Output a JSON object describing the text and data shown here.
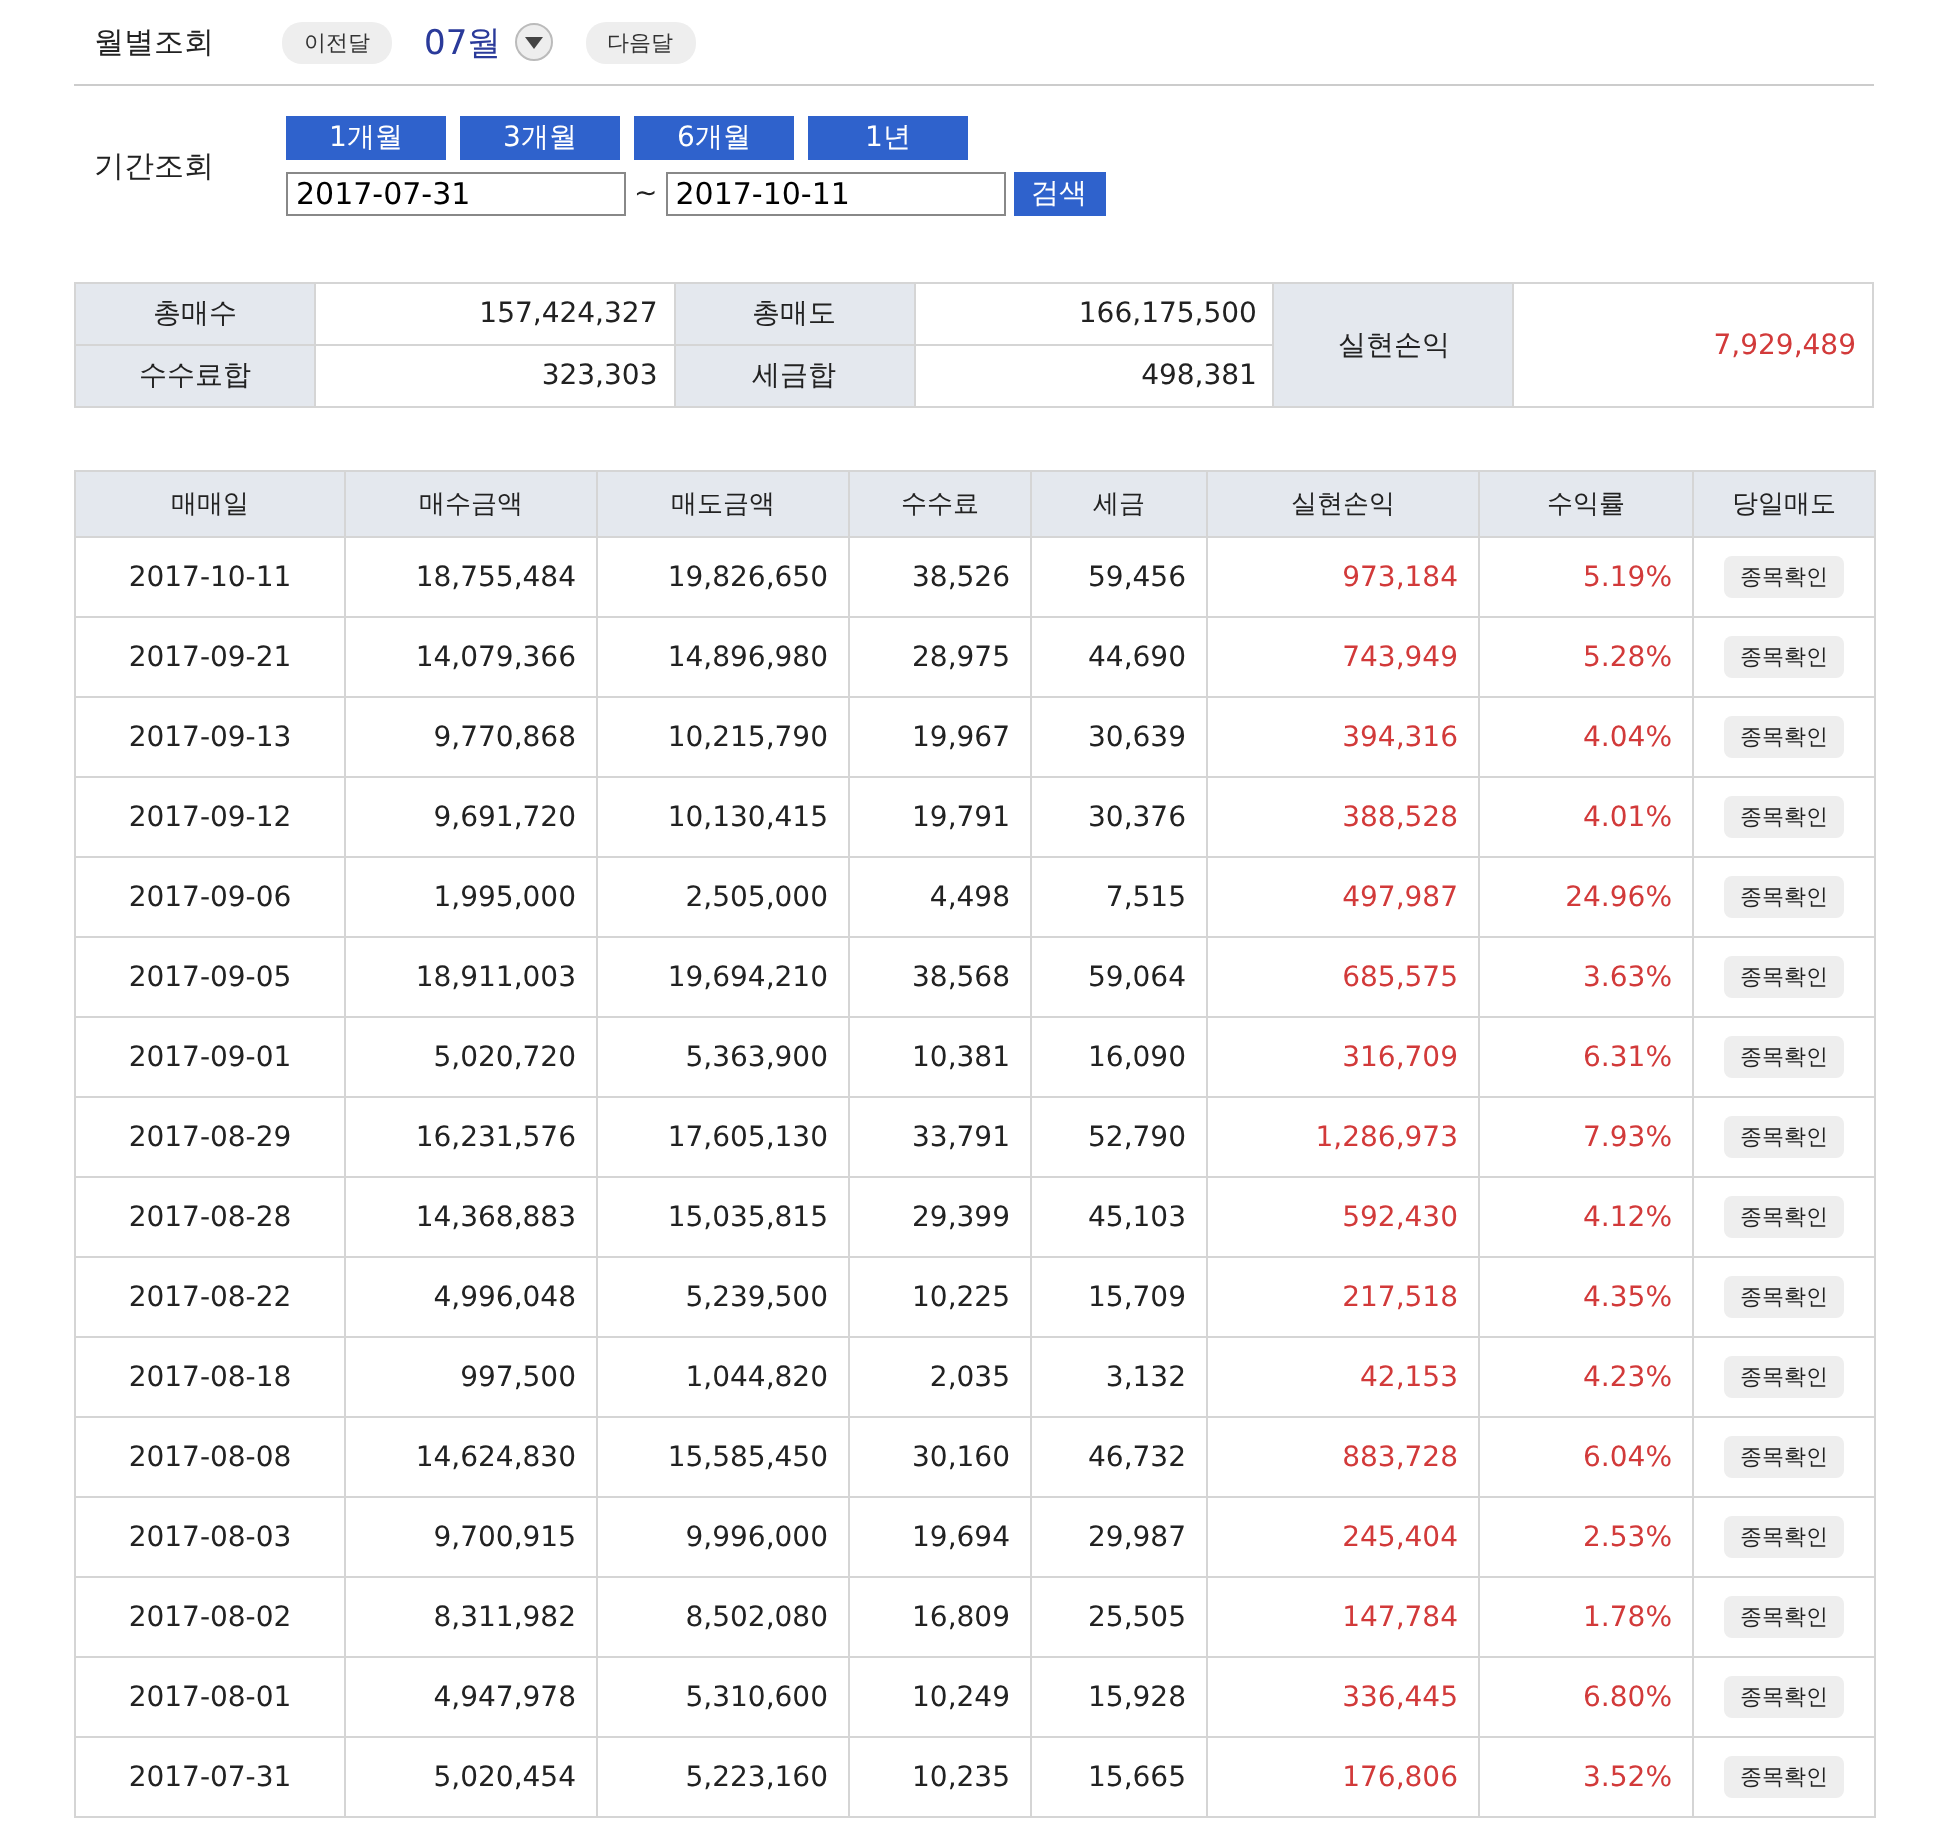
{
  "monthly": {
    "label": "월별조회",
    "prev": "이전달",
    "month": "07월",
    "next": "다음달"
  },
  "period": {
    "label": "기간조회",
    "presets": [
      "1개월",
      "3개월",
      "6개월",
      "1년"
    ],
    "from": "2017-07-31",
    "separator": "~",
    "to": "2017-10-11",
    "search": "검색"
  },
  "summary": {
    "buy_label": "총매수",
    "buy": "157,424,327",
    "sell_label": "총매도",
    "sell": "166,175,500",
    "fee_label": "수수료합",
    "fee": "323,303",
    "tax_label": "세금합",
    "tax": "498,381",
    "profit_label": "실현손익",
    "profit": "7,929,489"
  },
  "table": {
    "columns": [
      "매매일",
      "매수금액",
      "매도금액",
      "수수료",
      "세금",
      "실현손익",
      "수익률",
      "당일매도"
    ],
    "rows": [
      {
        "date": "2017-10-11",
        "buy": "18,755,484",
        "sell": "19,826,650",
        "fee": "38,526",
        "tax": "59,456",
        "profit": "973,184",
        "rate": "5.19%",
        "action": "종목확인"
      },
      {
        "date": "2017-09-21",
        "buy": "14,079,366",
        "sell": "14,896,980",
        "fee": "28,975",
        "tax": "44,690",
        "profit": "743,949",
        "rate": "5.28%",
        "action": "종목확인"
      },
      {
        "date": "2017-09-13",
        "buy": "9,770,868",
        "sell": "10,215,790",
        "fee": "19,967",
        "tax": "30,639",
        "profit": "394,316",
        "rate": "4.04%",
        "action": "종목확인"
      },
      {
        "date": "2017-09-12",
        "buy": "9,691,720",
        "sell": "10,130,415",
        "fee": "19,791",
        "tax": "30,376",
        "profit": "388,528",
        "rate": "4.01%",
        "action": "종목확인"
      },
      {
        "date": "2017-09-06",
        "buy": "1,995,000",
        "sell": "2,505,000",
        "fee": "4,498",
        "tax": "7,515",
        "profit": "497,987",
        "rate": "24.96%",
        "action": "종목확인"
      },
      {
        "date": "2017-09-05",
        "buy": "18,911,003",
        "sell": "19,694,210",
        "fee": "38,568",
        "tax": "59,064",
        "profit": "685,575",
        "rate": "3.63%",
        "action": "종목확인"
      },
      {
        "date": "2017-09-01",
        "buy": "5,020,720",
        "sell": "5,363,900",
        "fee": "10,381",
        "tax": "16,090",
        "profit": "316,709",
        "rate": "6.31%",
        "action": "종목확인"
      },
      {
        "date": "2017-08-29",
        "buy": "16,231,576",
        "sell": "17,605,130",
        "fee": "33,791",
        "tax": "52,790",
        "profit": "1,286,973",
        "rate": "7.93%",
        "action": "종목확인"
      },
      {
        "date": "2017-08-28",
        "buy": "14,368,883",
        "sell": "15,035,815",
        "fee": "29,399",
        "tax": "45,103",
        "profit": "592,430",
        "rate": "4.12%",
        "action": "종목확인"
      },
      {
        "date": "2017-08-22",
        "buy": "4,996,048",
        "sell": "5,239,500",
        "fee": "10,225",
        "tax": "15,709",
        "profit": "217,518",
        "rate": "4.35%",
        "action": "종목확인"
      },
      {
        "date": "2017-08-18",
        "buy": "997,500",
        "sell": "1,044,820",
        "fee": "2,035",
        "tax": "3,132",
        "profit": "42,153",
        "rate": "4.23%",
        "action": "종목확인"
      },
      {
        "date": "2017-08-08",
        "buy": "14,624,830",
        "sell": "15,585,450",
        "fee": "30,160",
        "tax": "46,732",
        "profit": "883,728",
        "rate": "6.04%",
        "action": "종목확인"
      },
      {
        "date": "2017-08-03",
        "buy": "9,700,915",
        "sell": "9,996,000",
        "fee": "19,694",
        "tax": "29,987",
        "profit": "245,404",
        "rate": "2.53%",
        "action": "종목확인"
      },
      {
        "date": "2017-08-02",
        "buy": "8,311,982",
        "sell": "8,502,080",
        "fee": "16,809",
        "tax": "25,505",
        "profit": "147,784",
        "rate": "1.78%",
        "action": "종목확인"
      },
      {
        "date": "2017-08-01",
        "buy": "4,947,978",
        "sell": "5,310,600",
        "fee": "10,249",
        "tax": "15,928",
        "profit": "336,445",
        "rate": "6.80%",
        "action": "종목확인"
      },
      {
        "date": "2017-07-31",
        "buy": "5,020,454",
        "sell": "5,223,160",
        "fee": "10,235",
        "tax": "15,665",
        "profit": "176,806",
        "rate": "3.52%",
        "action": "종목확인"
      }
    ]
  }
}
